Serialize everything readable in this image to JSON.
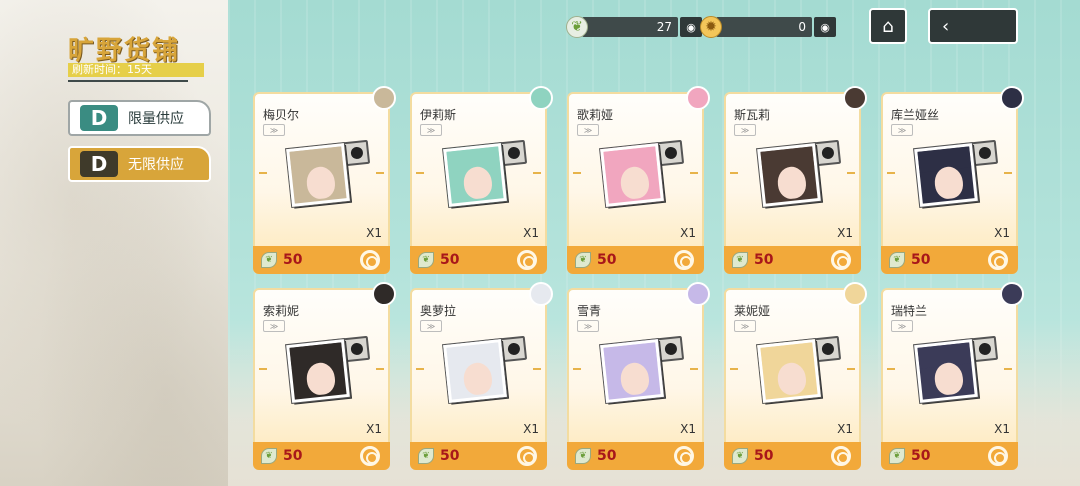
{
  "shop": {
    "title": "旷野货铺",
    "subtitle": "刷新时间：15天",
    "tabs": [
      {
        "label": "限量供应",
        "icon": "d-shield-icon"
      },
      {
        "label": "无限供应",
        "icon": "d-shield-icon"
      }
    ]
  },
  "currency": [
    {
      "icon": "leaf-token-icon",
      "value": "27"
    },
    {
      "icon": "gold-medal-icon",
      "value": "0"
    }
  ],
  "nav": {
    "home_icon": "home-icon",
    "back_icon": "back-arrow-icon"
  },
  "items": [
    {
      "name": "梅贝尔",
      "quantity": "X1",
      "price": "50",
      "hair": "#c9b89a"
    },
    {
      "name": "伊莉斯",
      "quantity": "X1",
      "price": "50",
      "hair": "#8fd3c0"
    },
    {
      "name": "歌莉娅",
      "quantity": "X1",
      "price": "50",
      "hair": "#f1a6bf"
    },
    {
      "name": "斯瓦莉",
      "quantity": "X1",
      "price": "50",
      "hair": "#4a3a33"
    },
    {
      "name": "库兰娅丝",
      "quantity": "X1",
      "price": "50",
      "hair": "#2d2f45"
    },
    {
      "name": "索莉妮",
      "quantity": "X1",
      "price": "50",
      "hair": "#2f2a28"
    },
    {
      "name": "奥萝拉",
      "quantity": "X1",
      "price": "50",
      "hair": "#e6e9ef"
    },
    {
      "name": "雪青",
      "quantity": "X1",
      "price": "50",
      "hair": "#c6b9e8"
    },
    {
      "name": "莱妮娅",
      "quantity": "X1",
      "price": "50",
      "hair": "#f0d69a"
    },
    {
      "name": "瑞特兰",
      "quantity": "X1",
      "price": "50",
      "hair": "#3b3b58"
    }
  ]
}
